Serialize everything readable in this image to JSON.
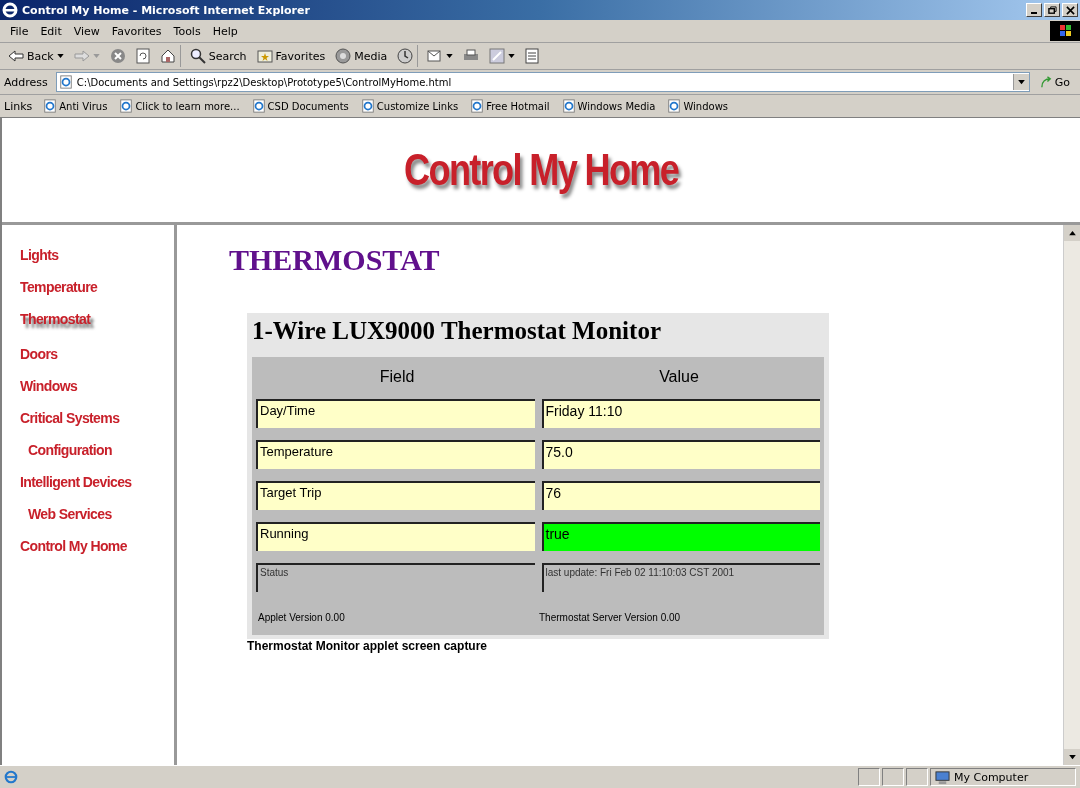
{
  "window": {
    "title": "Control My Home - Microsoft Internet Explorer"
  },
  "menu": [
    "File",
    "Edit",
    "View",
    "Favorites",
    "Tools",
    "Help"
  ],
  "toolbar": [
    {
      "kind": "back",
      "label": "Back"
    },
    {
      "kind": "forward"
    },
    {
      "kind": "stop"
    },
    {
      "kind": "refresh"
    },
    {
      "kind": "home"
    },
    {
      "kind": "search",
      "label": "Search"
    },
    {
      "kind": "favorites",
      "label": "Favorites"
    },
    {
      "kind": "media",
      "label": "Media"
    },
    {
      "kind": "history"
    },
    {
      "kind": "mail"
    },
    {
      "kind": "print"
    },
    {
      "kind": "edit"
    },
    {
      "kind": "discuss"
    }
  ],
  "address": {
    "label": "Address",
    "value": "C:\\Documents and Settings\\rpz2\\Desktop\\Prototype5\\ControlMyHome.html",
    "go": "Go"
  },
  "links": {
    "label": "Links",
    "items": [
      "Anti Virus",
      "Click to learn more...",
      "CSD Documents",
      "Customize Links",
      "Free Hotmail",
      "Windows Media",
      "Windows"
    ]
  },
  "banner": {
    "title": "Control My Home"
  },
  "sidebar": {
    "items": [
      {
        "label": "Lights",
        "selected": false,
        "indented": false
      },
      {
        "label": "Temperature",
        "selected": false,
        "indented": false
      },
      {
        "label": "Thermostat",
        "selected": true,
        "indented": false
      },
      {
        "label": "Doors",
        "selected": false,
        "indented": false
      },
      {
        "label": "Windows",
        "selected": false,
        "indented": false
      },
      {
        "label": "Critical Systems",
        "selected": false,
        "indented": false
      },
      {
        "label": "Configuration",
        "selected": false,
        "indented": true
      },
      {
        "label": "Intelligent Devices",
        "selected": false,
        "indented": false
      },
      {
        "label": "Web Services",
        "selected": false,
        "indented": true
      },
      {
        "label": "Control My Home",
        "selected": false,
        "indented": false
      }
    ]
  },
  "page": {
    "heading": "THERMOSTAT",
    "monitor": {
      "title": "1-Wire LUX9000 Thermostat Monitor",
      "columns": [
        "Field",
        "Value"
      ],
      "rows": [
        {
          "field": "Day/Time",
          "value": "Friday  11:10",
          "active": false
        },
        {
          "field": "Temperature",
          "value": "75.0",
          "active": false
        },
        {
          "field": "Target Trip",
          "value": "76",
          "active": false
        },
        {
          "field": "Running",
          "value": "true",
          "active": true
        }
      ],
      "status": {
        "field": "Status",
        "value": "last update: Fri Feb 02 11:10:03 CST 2001"
      },
      "versions": [
        "Applet Version 0.00",
        "Thermostat Server Version 0.00"
      ]
    },
    "caption": "Thermostat Monitor applet screen capture"
  },
  "status_bar": {
    "zone": "My Computer"
  }
}
